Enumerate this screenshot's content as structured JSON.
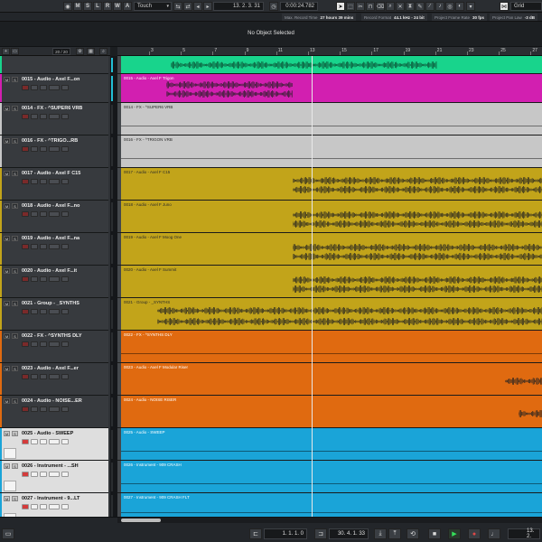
{
  "toolbar": {
    "letters": [
      "M",
      "S",
      "L",
      "R",
      "W",
      "A"
    ],
    "automation_mode": "Touch",
    "left_position": "13. 2. 3. 31",
    "timecode": "0:00:24.782",
    "grid_type": "Grid"
  },
  "infobar": {
    "items": [
      {
        "label": "Max. Record Time",
        "value": "27 hours 39 mins"
      },
      {
        "label": "Record Format",
        "value": "44.1 kHz - 24 bit"
      },
      {
        "label": "Project Frame Rate",
        "value": "30 fps"
      },
      {
        "label": "Project Pan Law",
        "value": "-3 dB"
      }
    ]
  },
  "status": {
    "message": "No Object Selected"
  },
  "track_header": {
    "count": "20 / 20"
  },
  "ruler": {
    "bars": [
      "3",
      "5",
      "7",
      "9",
      "11",
      "13",
      "15",
      "17",
      "19",
      "21",
      "23",
      "25",
      "27"
    ]
  },
  "tracks": [
    {
      "name": "",
      "clip_label": "",
      "color": "#18d48c",
      "light": false
    },
    {
      "name": "0015 - Audio - Axel F...on",
      "clip_label": "0015 - Audio - Axel F Trigon",
      "color": "#d21fb0",
      "light": false
    },
    {
      "name": "0014 - FX - ^SUPER6 VRB",
      "clip_label": "0014 - FX - ^SUPER6 VRB",
      "color": "#c7c7c7",
      "light": false
    },
    {
      "name": "0016 - FX - ^TRIGO...RB",
      "clip_label": "0016 - FX - ^TRIGON VRB",
      "color": "#c7c7c7",
      "light": false
    },
    {
      "name": "0017 - Audio - Axel F C15",
      "clip_label": "0017 - Audio - Axel F C15",
      "color": "#c2a41a",
      "light": false
    },
    {
      "name": "0018 - Audio - Axel F...no",
      "clip_label": "0018 - Audio - Axel F Juno",
      "color": "#c2a41a",
      "light": false
    },
    {
      "name": "0019 - Audio - Axel F...na",
      "clip_label": "0019 - Audio - Axel F Moog One",
      "color": "#c2a41a",
      "light": false
    },
    {
      "name": "0020 - Audio - Axel F...it",
      "clip_label": "0020 - Audio - Axel F Summit",
      "color": "#c2a41a",
      "light": false
    },
    {
      "name": "0021 - Group - _SYNTHS",
      "clip_label": "0021 - Group - _SYNTHS",
      "color": "#c2a41a",
      "light": false
    },
    {
      "name": "0022 - FX - ^SYNTHS DLY",
      "clip_label": "0022 - FX - ^SYNTHS DLY",
      "color": "#e06a10",
      "light": false
    },
    {
      "name": "0023 - Audio - Axel F...er",
      "clip_label": "0023 - Audio - Axel F Modular Riser",
      "color": "#e06a10",
      "light": false
    },
    {
      "name": "0024 - Audio - NOISE...ER",
      "clip_label": "0024 - Audio - NOISE RISER",
      "color": "#e06a10",
      "light": false
    },
    {
      "name": "0025 - Audio - SWEEP",
      "clip_label": "0025 - Audio - SWEEP",
      "color": "#1aa4d8",
      "light": true
    },
    {
      "name": "0026 - Instrument - ...SH",
      "clip_label": "0026 - Instrument - 909 CRASH",
      "color": "#1aa4d8",
      "light": true
    },
    {
      "name": "0027 - Instrument - 9...LT",
      "clip_label": "0027 - Instrument - 909 CRASH FLT",
      "color": "#1aa4d8",
      "light": true
    }
  ],
  "transport": {
    "left_locator": "1. 1. 1. 0",
    "right_locator": "30. 4. 1. 33",
    "position": "13. 2."
  }
}
